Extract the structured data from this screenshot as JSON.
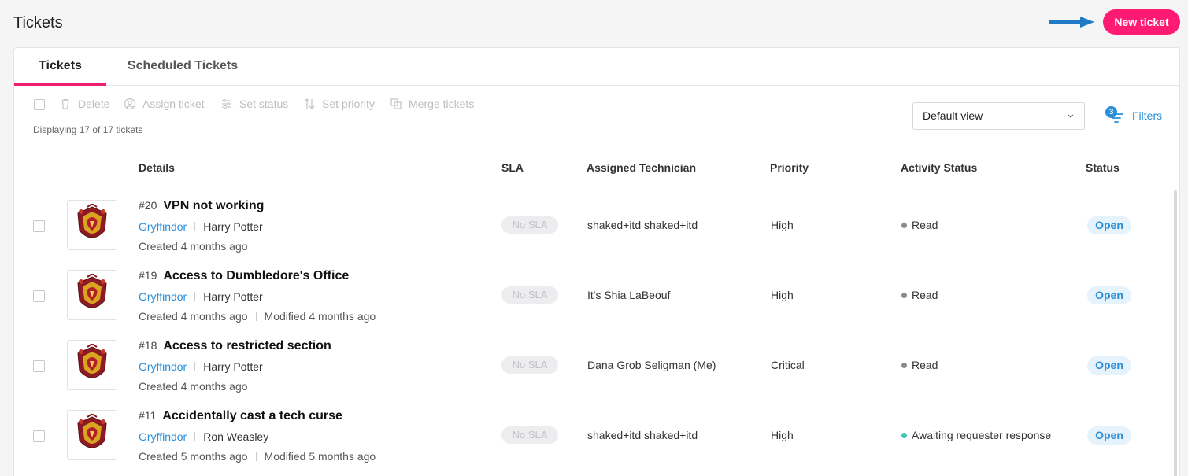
{
  "header": {
    "title": "Tickets",
    "new_ticket_label": "New ticket",
    "accent": "#ff1a73"
  },
  "tabs": [
    {
      "label": "Tickets",
      "active": true
    },
    {
      "label": "Scheduled Tickets",
      "active": false
    }
  ],
  "toolbar": {
    "actions": [
      {
        "label": "Delete",
        "icon": "trash-icon"
      },
      {
        "label": "Assign ticket",
        "icon": "user-circle-icon"
      },
      {
        "label": "Set status",
        "icon": "sliders-icon"
      },
      {
        "label": "Set priority",
        "icon": "sort-arrows-icon"
      },
      {
        "label": "Merge tickets",
        "icon": "merge-icon"
      }
    ],
    "displaying": "Displaying 17 of 17 tickets",
    "view_select": "Default view",
    "filters_label": "Filters",
    "filters_count": "3"
  },
  "columns": [
    "Details",
    "SLA",
    "Assigned Technician",
    "Priority",
    "Activity Status",
    "Status"
  ],
  "tickets": [
    {
      "number": "#20",
      "title": "VPN not working",
      "group": "Gryffindor",
      "requester": "Harry Potter",
      "created": "Created 4 months ago",
      "modified": "",
      "sla": "No SLA",
      "technician": "shaked+itd shaked+itd",
      "priority": "High",
      "activity": "Read",
      "activity_color": "#8a8a8e",
      "status": "Open"
    },
    {
      "number": "#19",
      "title": "Access to Dumbledore's Office",
      "group": "Gryffindor",
      "requester": "Harry Potter",
      "created": "Created 4 months ago",
      "modified": "Modified 4 months ago",
      "sla": "No SLA",
      "technician": "It's Shia LaBeouf",
      "priority": "High",
      "activity": "Read",
      "activity_color": "#8a8a8e",
      "status": "Open"
    },
    {
      "number": "#18",
      "title": "Access to restricted section",
      "group": "Gryffindor",
      "requester": "Harry Potter",
      "created": "Created 4 months ago",
      "modified": "",
      "sla": "No SLA",
      "technician": "Dana Grob Seligman (Me)",
      "priority": "Critical",
      "activity": "Read",
      "activity_color": "#8a8a8e",
      "status": "Open"
    },
    {
      "number": "#11",
      "title": "Accidentally cast a tech curse",
      "group": "Gryffindor",
      "requester": "Ron Weasley",
      "created": "Created 5 months ago",
      "modified": "Modified 5 months ago",
      "sla": "No SLA",
      "technician": "shaked+itd shaked+itd",
      "priority": "High",
      "activity": "Awaiting requester response",
      "activity_color": "#3cc7b5",
      "status": "Open"
    }
  ]
}
